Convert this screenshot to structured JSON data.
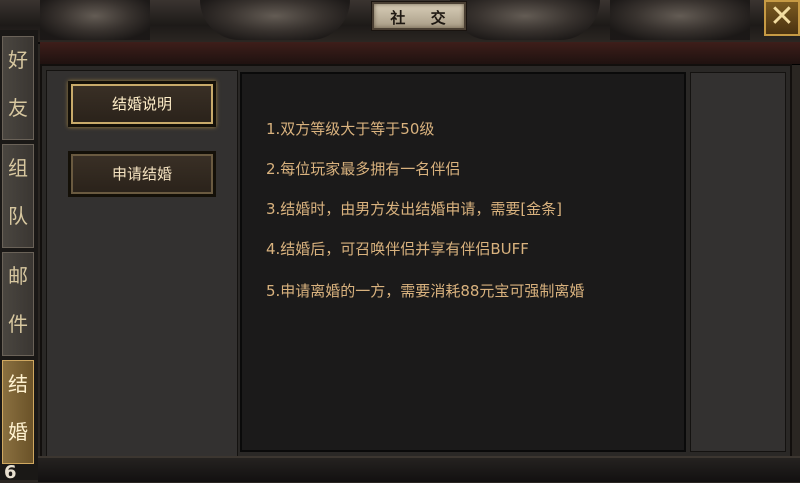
{
  "window": {
    "title": "社 交",
    "close_glyph": "✕"
  },
  "tabs": [
    {
      "chars": [
        "好",
        "友"
      ],
      "active": false
    },
    {
      "chars": [
        "组",
        "队"
      ],
      "active": false
    },
    {
      "chars": [
        "邮",
        "件"
      ],
      "active": false
    },
    {
      "chars": [
        "结",
        "婚"
      ],
      "active": true
    }
  ],
  "tab_badge": "6",
  "side_buttons": [
    {
      "label": "结婚说明",
      "active": true
    },
    {
      "label": "申请结婚",
      "active": false
    }
  ],
  "rules": [
    "1.双方等级大于等于50级",
    "2.每位玩家最多拥有一名伴侣",
    "3.结婚时，由男方发出结婚申请，需要[金条]",
    "4.结婚后，可召唤伴侣并享有伴侣BUFF",
    "5.申请离婚的一方，需要消耗88元宝可强制离婚"
  ],
  "colors": {
    "rule_text": "#d9b27e",
    "accent_gold": "#c8aa6a"
  }
}
